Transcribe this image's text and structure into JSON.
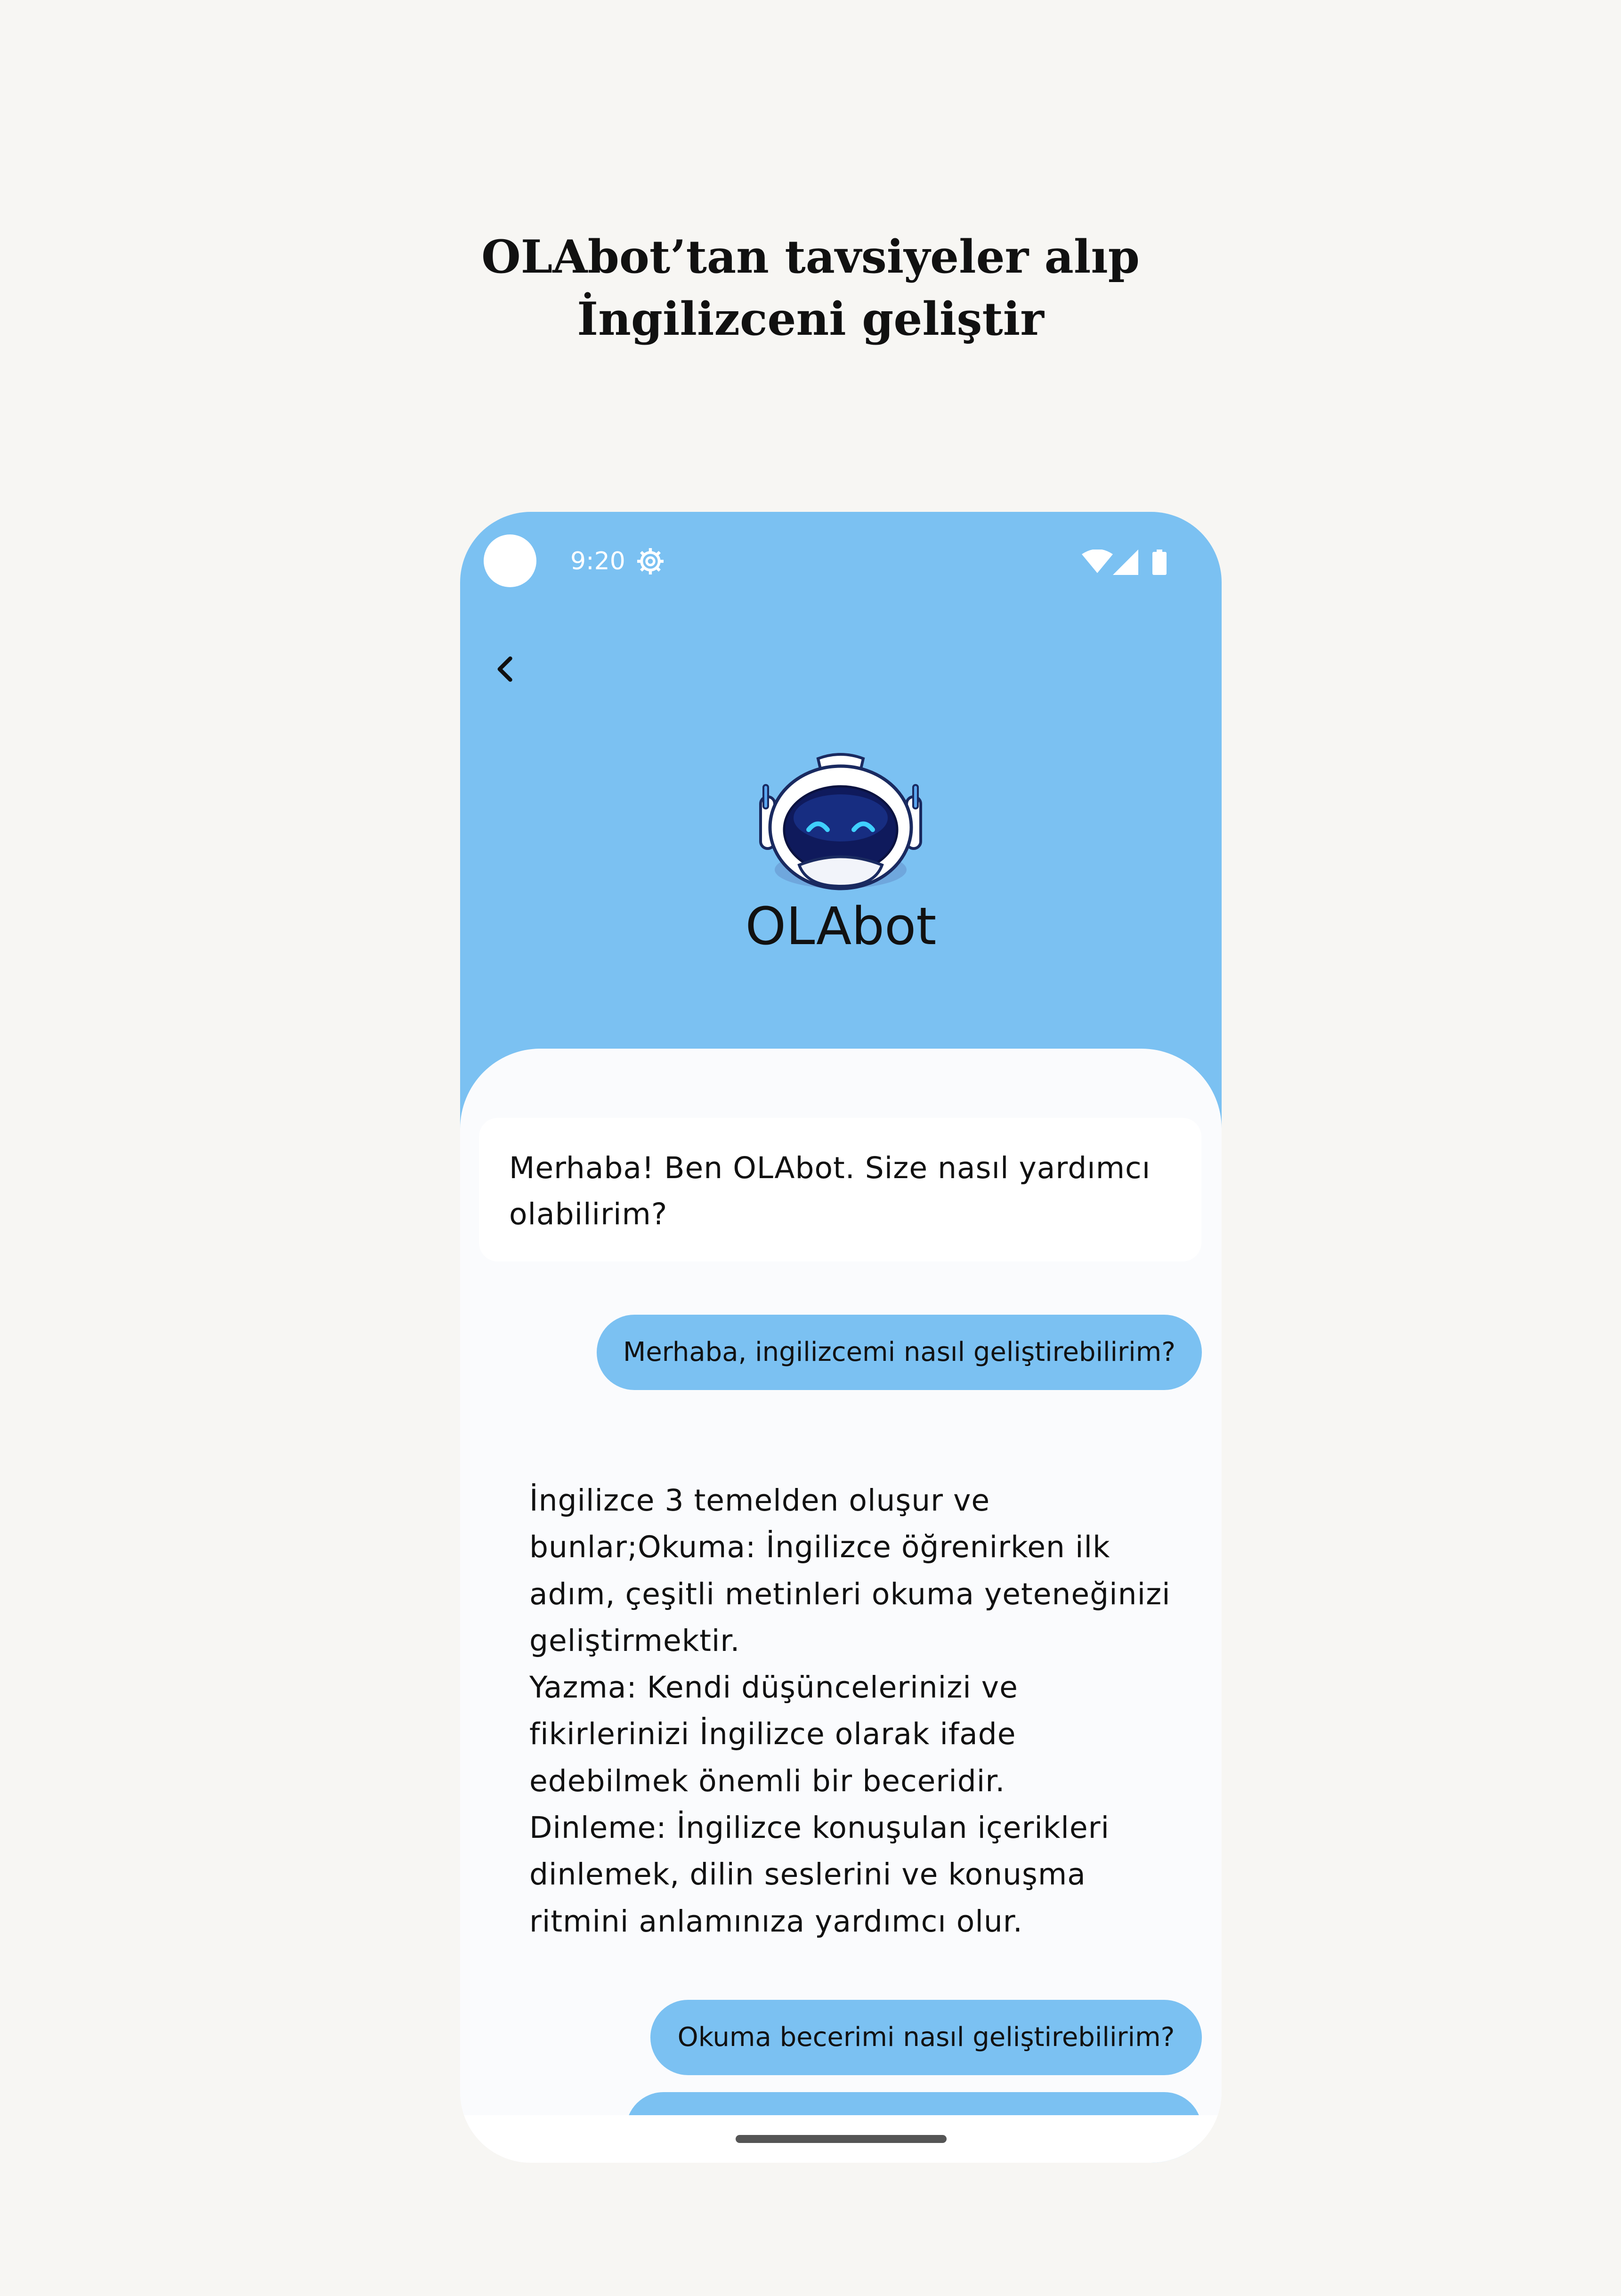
{
  "headline": {
    "line1": "OLAbot’tan tavsiyeler alıp",
    "line2": "İngilizceni geliştir"
  },
  "status_bar": {
    "time": "9:20",
    "icons": [
      "settings-icon",
      "wifi-icon",
      "signal-icon",
      "battery-icon"
    ]
  },
  "header": {
    "back_icon": "chevron-left-icon",
    "bot_avatar": "robot-icon",
    "bot_name": "OLAbot"
  },
  "messages": {
    "bot_1": {
      "line1": "Merhaba! Ben OLAbot. Size nasıl yardımcı",
      "line2": "olabilirim?"
    },
    "user_1": "Merhaba, ingilizcemi nasıl geliştirebilirim?",
    "bot_2": {
      "lines": [
        "İngilizce 3 temelden oluşur ve",
        "bunlar;Okuma: İngilizce öğrenirken ilk",
        "adım, çeşitli metinleri okuma yeteneğinizi",
        "geliştirmektir.",
        "Yazma: Kendi düşüncelerinizi ve",
        "fikirlerinizi İngilizce olarak ifade",
        "edebilmek önemli bir beceridir.",
        "Dinleme: İngilizce konuşulan içerikleri",
        "dinlemek, dilin seslerini ve konuşma",
        "ritmini anlamınıza yardımcı olur."
      ]
    },
    "user_2": "Okuma becerimi nasıl geliştirebilirim?"
  },
  "colors": {
    "background": "#f7f6f3",
    "header_blue": "#7bc1f2",
    "chat_bg": "#fafbfd",
    "bot_card": "#ffffff",
    "user_bubble": "#7bc1f2"
  }
}
